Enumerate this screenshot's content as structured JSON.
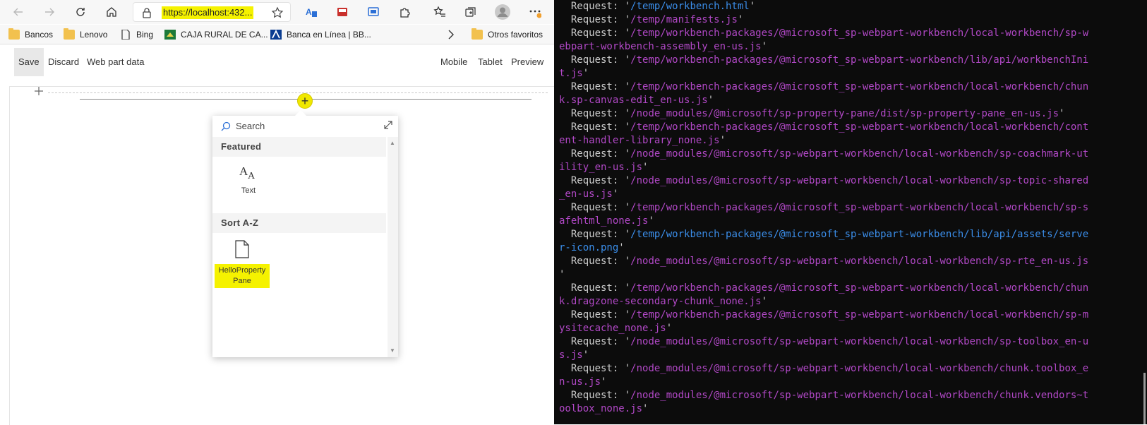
{
  "browser": {
    "url": "https://localhost:432...",
    "bookmarks": [
      {
        "label": "Bancos",
        "icon": "folder-icon"
      },
      {
        "label": "Lenovo",
        "icon": "folder-icon"
      },
      {
        "label": "Bing",
        "icon": "page-icon"
      },
      {
        "label": "CAJA RURAL DE CA...",
        "icon": "bank-logo-icon"
      },
      {
        "label": "Banca en Línea | BB...",
        "icon": "bbva-logo-icon"
      },
      {
        "label": "Otros favoritos",
        "icon": "folder-icon"
      }
    ],
    "accent": "#f5f200"
  },
  "workbench": {
    "save": "Save",
    "discard": "Discard",
    "webpart_data": "Web part data",
    "mobile": "Mobile",
    "tablet": "Tablet",
    "preview": "Preview"
  },
  "toolbox": {
    "search_placeholder": "Search",
    "featured_header": "Featured",
    "featured_item": "Text",
    "sort_header": "Sort A-Z",
    "custom_item_line1": "HelloProperty",
    "custom_item_line2": "Pane"
  },
  "terminal": {
    "prefix": "  Request: ",
    "lines": [
      {
        "text": "  Request: '",
        "path": "/temp/workbench.html",
        "end": "'",
        "color": "blue"
      },
      {
        "text": "  Request: '",
        "path": "/temp/manifests.js",
        "end": "'",
        "color": "magenta"
      },
      {
        "text": "  Request: '",
        "path": "/temp/workbench-packages/@microsoft_sp-webpart-workbench/local-workbench/sp-w",
        "end": "",
        "color": "magenta"
      },
      {
        "text": "",
        "path": "ebpart-workbench-assembly_en-us.js",
        "end": "'",
        "color": "magenta"
      },
      {
        "text": "  Request: '",
        "path": "/temp/workbench-packages/@microsoft_sp-webpart-workbench/lib/api/workbenchIni",
        "end": "",
        "color": "magenta"
      },
      {
        "text": "",
        "path": "t.js",
        "end": "'",
        "color": "magenta"
      },
      {
        "text": "  Request: '",
        "path": "/temp/workbench-packages/@microsoft_sp-webpart-workbench/local-workbench/chun",
        "end": "",
        "color": "magenta"
      },
      {
        "text": "",
        "path": "k.sp-canvas-edit_en-us.js",
        "end": "'",
        "color": "magenta"
      },
      {
        "text": "  Request: '",
        "path": "/node_modules/@microsoft/sp-property-pane/dist/sp-property-pane_en-us.js",
        "end": "'",
        "color": "magenta"
      },
      {
        "text": "  Request: '",
        "path": "/temp/workbench-packages/@microsoft_sp-webpart-workbench/local-workbench/cont",
        "end": "",
        "color": "magenta"
      },
      {
        "text": "",
        "path": "ent-handler-library_none.js",
        "end": "'",
        "color": "magenta"
      },
      {
        "text": "  Request: '",
        "path": "/node_modules/@microsoft/sp-webpart-workbench/local-workbench/sp-coachmark-ut",
        "end": "",
        "color": "magenta"
      },
      {
        "text": "",
        "path": "ility_en-us.js",
        "end": "'",
        "color": "magenta"
      },
      {
        "text": "  Request: '",
        "path": "/node_modules/@microsoft/sp-webpart-workbench/local-workbench/sp-topic-shared",
        "end": "",
        "color": "magenta"
      },
      {
        "text": "",
        "path": "_en-us.js",
        "end": "'",
        "color": "magenta"
      },
      {
        "text": "  Request: '",
        "path": "/temp/workbench-packages/@microsoft_sp-webpart-workbench/local-workbench/sp-s",
        "end": "",
        "color": "magenta"
      },
      {
        "text": "",
        "path": "afehtml_none.js",
        "end": "'",
        "color": "magenta"
      },
      {
        "text": "  Request: '",
        "path": "/temp/workbench-packages/@microsoft_sp-webpart-workbench/lib/api/assets/serve",
        "end": "",
        "color": "blue"
      },
      {
        "text": "",
        "path": "r-icon.png",
        "end": "'",
        "color": "blue"
      },
      {
        "text": "  Request: '",
        "path": "/node_modules/@microsoft/sp-webpart-workbench/local-workbench/sp-rte_en-us.js",
        "end": "",
        "color": "magenta"
      },
      {
        "text": "'",
        "path": "",
        "end": "",
        "color": "magenta"
      },
      {
        "text": "  Request: '",
        "path": "/temp/workbench-packages/@microsoft_sp-webpart-workbench/local-workbench/chun",
        "end": "",
        "color": "magenta"
      },
      {
        "text": "",
        "path": "k.dragzone-secondary-chunk_none.js",
        "end": "'",
        "color": "magenta"
      },
      {
        "text": "  Request: '",
        "path": "/temp/workbench-packages/@microsoft_sp-webpart-workbench/local-workbench/sp-m",
        "end": "",
        "color": "magenta"
      },
      {
        "text": "",
        "path": "ysitecache_none.js",
        "end": "'",
        "color": "magenta"
      },
      {
        "text": "  Request: '",
        "path": "/node_modules/@microsoft/sp-webpart-workbench/local-workbench/sp-toolbox_en-u",
        "end": "",
        "color": "magenta"
      },
      {
        "text": "",
        "path": "s.js",
        "end": "'",
        "color": "magenta"
      },
      {
        "text": "  Request: '",
        "path": "/node_modules/@microsoft/sp-webpart-workbench/local-workbench/chunk.toolbox_e",
        "end": "",
        "color": "magenta"
      },
      {
        "text": "",
        "path": "n-us.js",
        "end": "'",
        "color": "magenta"
      },
      {
        "text": "  Request: '",
        "path": "/node_modules/@microsoft/sp-webpart-workbench/local-workbench/chunk.vendors~t",
        "end": "",
        "color": "magenta"
      },
      {
        "text": "",
        "path": "oolbox_none.js",
        "end": "'",
        "color": "magenta"
      }
    ]
  }
}
